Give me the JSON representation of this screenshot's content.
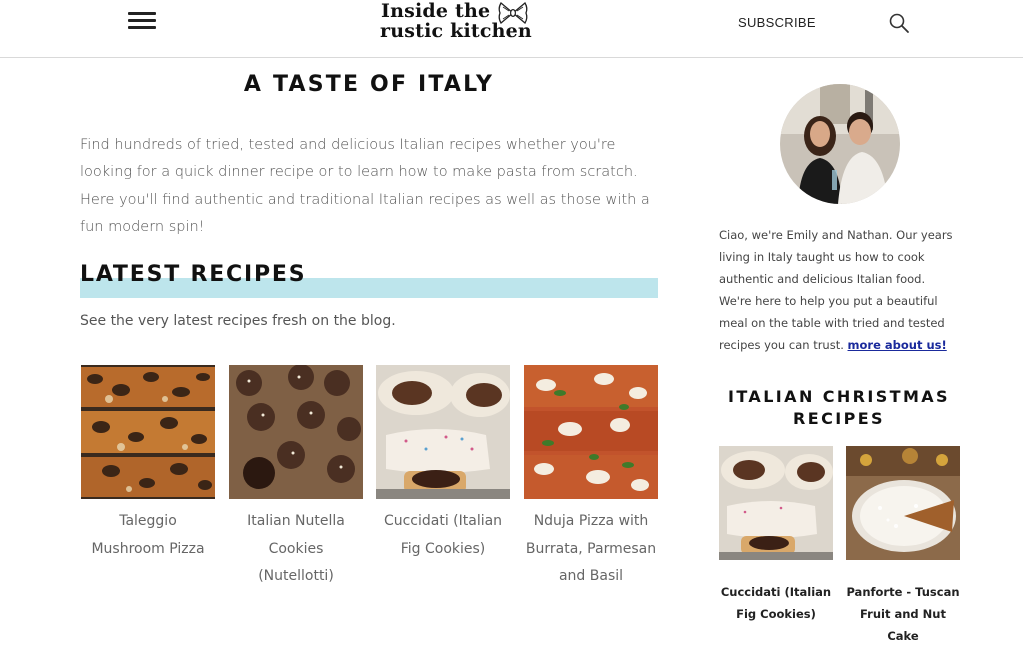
{
  "header": {
    "logo_line1": "Inside the",
    "logo_line2": "rustic kitchen",
    "subscribe_label": "SUBSCRIBE",
    "menu_icon": "hamburger-menu-icon",
    "search_icon": "search-icon"
  },
  "main": {
    "title": "A TASTE OF ITALY",
    "intro": "Find hundreds of tried, tested and delicious Italian recipes whether you're looking for a quick dinner recipe or to learn how to make pasta from scratch. Here you'll find authentic and traditional Italian recipes as well as those with a fun modern spin!",
    "latest_title": "LATEST RECIPES",
    "latest_subtitle": "See the very latest recipes fresh on the blog.",
    "highlight_color": "#bde5ec",
    "recipes": [
      {
        "label": "Taleggio Mushroom Pizza"
      },
      {
        "label": "Italian Nutella Cookies (Nutellotti)"
      },
      {
        "label": "Cuccidati (Italian Fig Cookies)"
      },
      {
        "label": "Nduja Pizza with Burrata, Parmesan and Basil"
      }
    ]
  },
  "sidebar": {
    "bio_text": "Ciao, we're Emily and Nathan. Our years living in Italy taught us how to cook authentic and delicious Italian food. We're here to help you put a beautiful meal on the table with tried and tested recipes you can trust.",
    "bio_link": "more about us!",
    "link_color": "#1a2a9c",
    "section_title": "ITALIAN CHRISTMAS RECIPES",
    "recipes": [
      {
        "label": "Cuccidati (Italian Fig Cookies)"
      },
      {
        "label": "Panforte - Tuscan Fruit and Nut Cake"
      }
    ]
  }
}
